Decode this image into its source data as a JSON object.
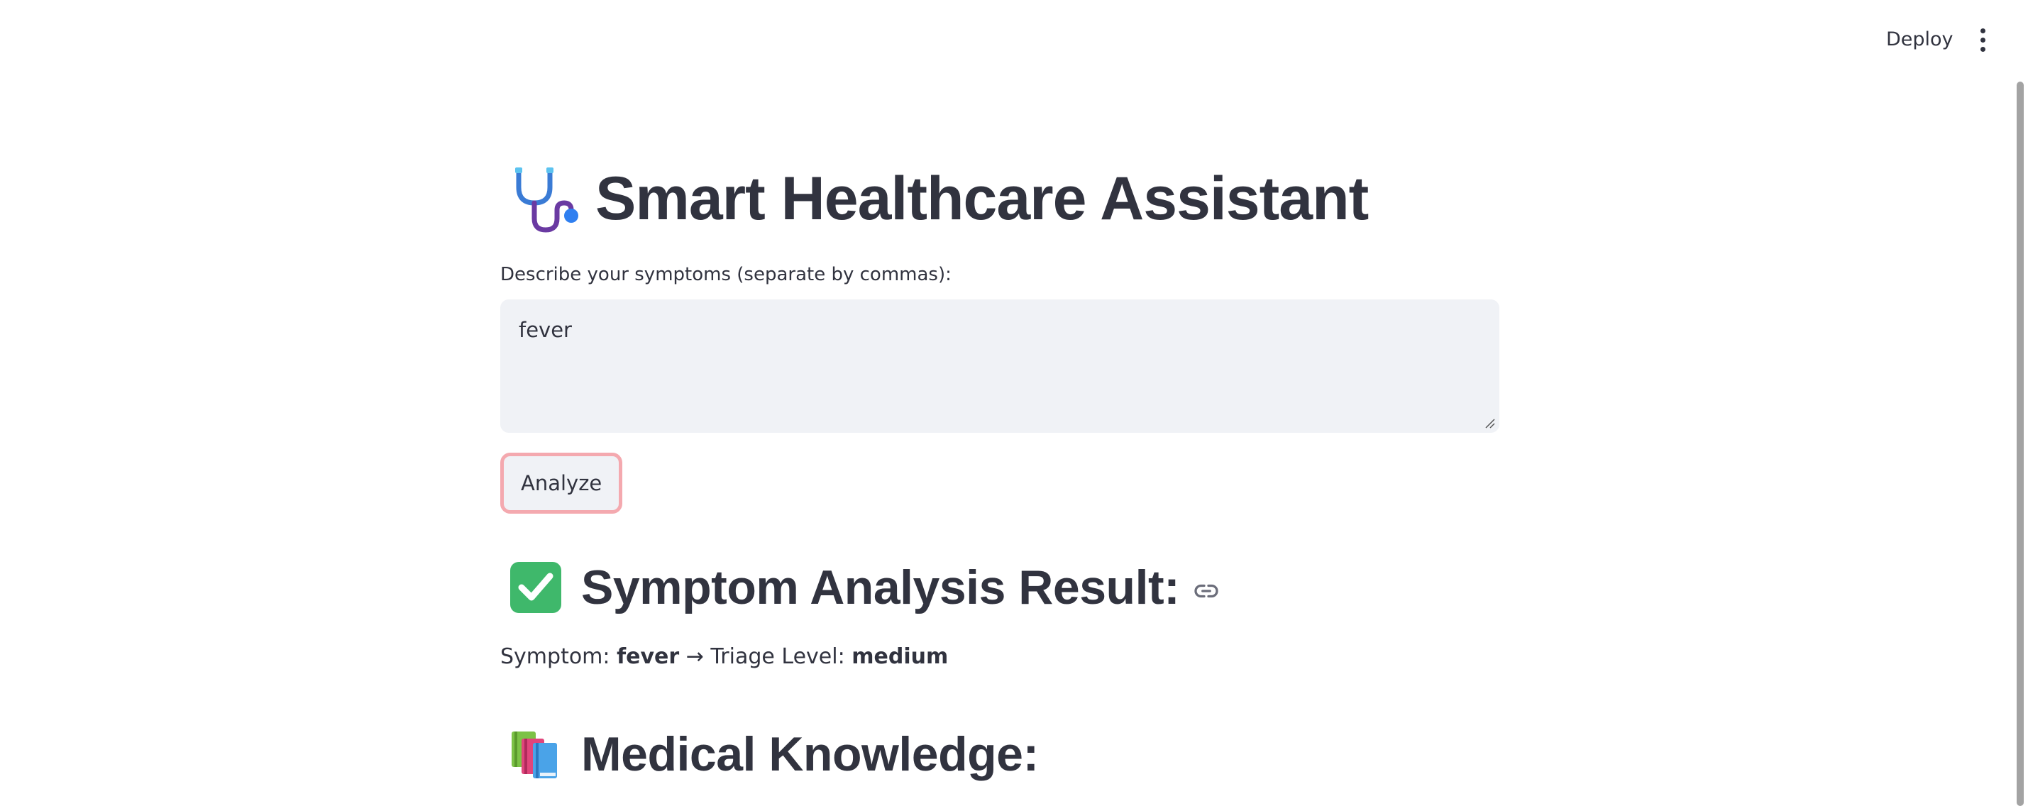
{
  "header": {
    "deploy_label": "Deploy",
    "menu_icon": "vertical-ellipsis-icon"
  },
  "title": {
    "icon": "stethoscope-icon",
    "text": "Smart Healthcare Assistant"
  },
  "symptom_input": {
    "label": "Describe your symptoms (separate by commas):",
    "value": "fever"
  },
  "analyze_button": {
    "label": "Analyze"
  },
  "result_section": {
    "icon": "check-mark-icon",
    "heading": "Symptom Analysis Result:",
    "anchor_icon": "link-icon",
    "symptom_prefix": "Symptom: ",
    "symptom_value": "fever",
    "arrow": " → ",
    "triage_prefix": "Triage Level: ",
    "triage_value": "medium"
  },
  "knowledge_section": {
    "icon": "books-icon",
    "heading": "Medical Knowledge:"
  },
  "colors": {
    "text": "#31333f",
    "input_bg": "#f0f2f6",
    "focus_border": "#f4a9af",
    "check_green": "#3fb86b",
    "scrollbar": "#a3a3a3"
  }
}
